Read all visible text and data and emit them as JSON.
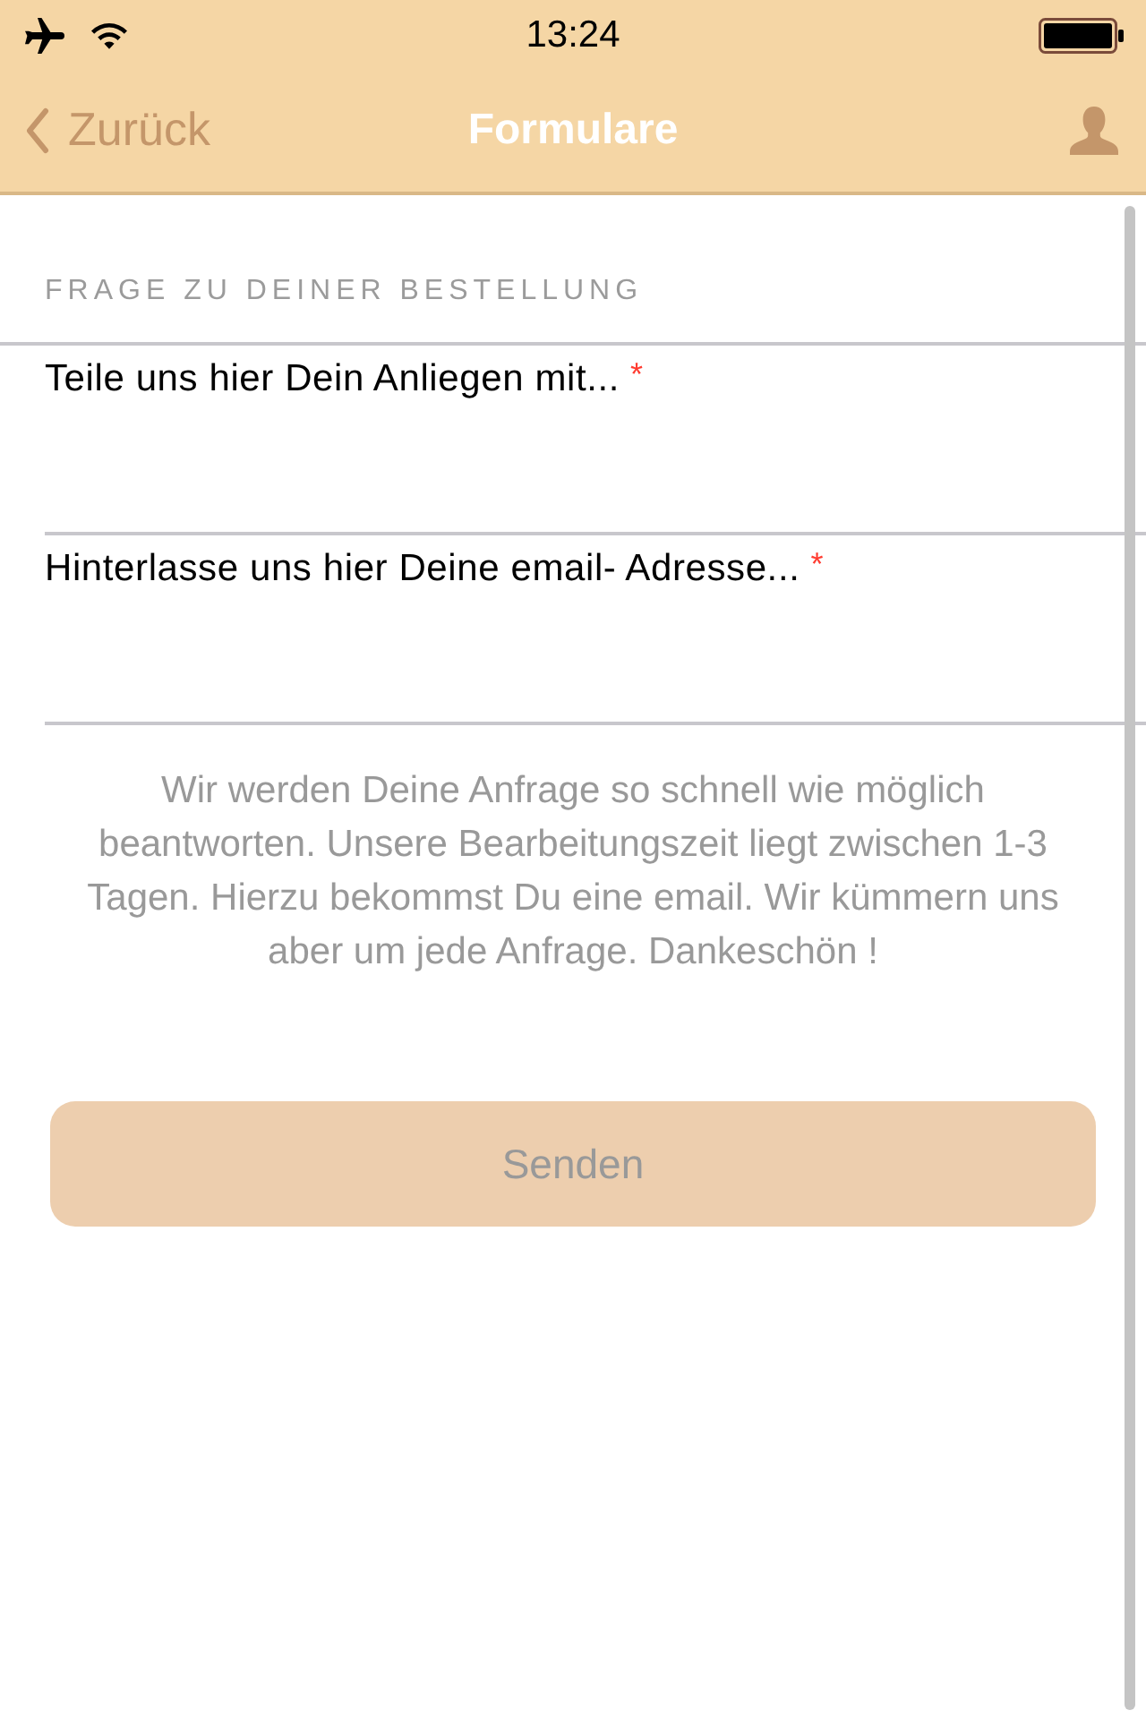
{
  "status_bar": {
    "time": "13:24"
  },
  "nav_bar": {
    "back": "Zurück",
    "title": "Formulare"
  },
  "section": {
    "header": "FRAGE ZU DEINER BESTELLUNG"
  },
  "fields": [
    {
      "label": "Teile uns hier Dein Anliegen mit...",
      "required_mark": "*"
    },
    {
      "label": "Hinterlasse uns hier Deine email- Adresse...",
      "required_mark": "*"
    }
  ],
  "note": "Wir werden Deine Anfrage so schnell wie möglich beantworten. Unsere Bearbeitungszeit liegt zwischen 1-3 Tagen. Hierzu bekommst Du eine email. Wir kümmern uns aber um jede Anfrage. Dankeschön !",
  "submit": {
    "label": "Senden",
    "disabled": true
  }
}
